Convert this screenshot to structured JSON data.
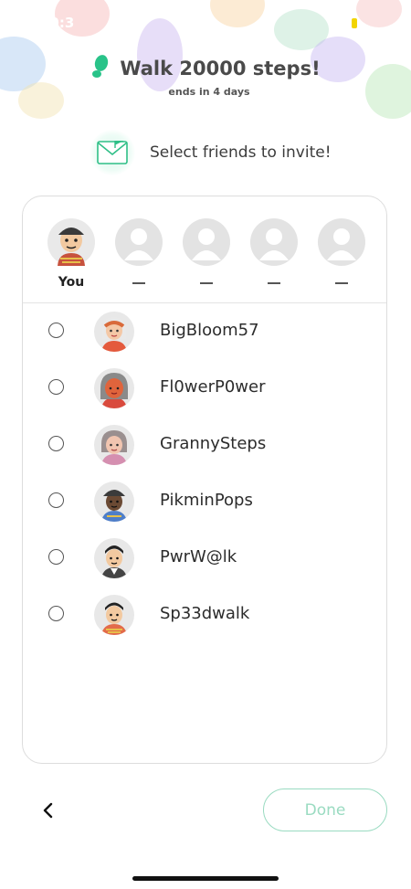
{
  "status": {
    "time": "10:3"
  },
  "challenge": {
    "title": "Walk 20000 steps!",
    "subtitle": "ends in 4 days",
    "icon": "footprint-icon",
    "accent": "#29c389"
  },
  "invite": {
    "label": "Select friends to invite!",
    "icon": "envelope-icon"
  },
  "slots": [
    {
      "label": "You",
      "avatar": "you-avatar"
    },
    {
      "label": "—",
      "avatar": "empty-avatar"
    },
    {
      "label": "—",
      "avatar": "empty-avatar"
    },
    {
      "label": "—",
      "avatar": "empty-avatar"
    },
    {
      "label": "—",
      "avatar": "empty-avatar"
    }
  ],
  "friends": [
    {
      "name": "BigBloom57",
      "selected": false
    },
    {
      "name": "Fl0werP0wer",
      "selected": false
    },
    {
      "name": "GrannySteps",
      "selected": false
    },
    {
      "name": "PikminPops",
      "selected": false
    },
    {
      "name": "PwrW@lk",
      "selected": false
    },
    {
      "name": "Sp33dwalk",
      "selected": false
    }
  ],
  "footer": {
    "back_icon": "chevron-left-icon",
    "done_label": "Done",
    "done_color": "#9adbc1"
  }
}
